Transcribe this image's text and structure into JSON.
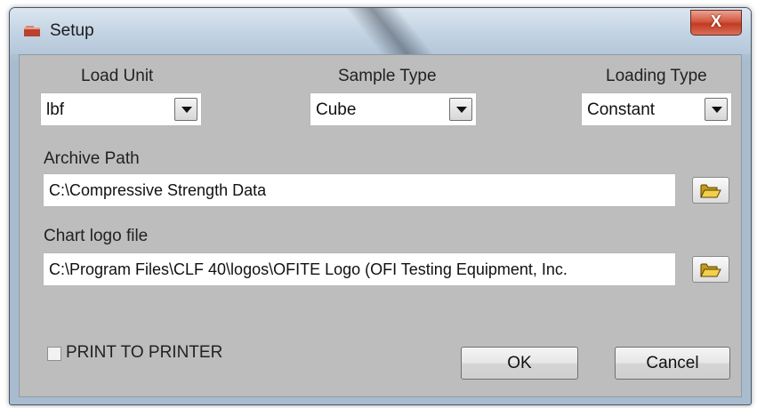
{
  "window": {
    "title": "Setup",
    "close_label": "X"
  },
  "load_unit": {
    "label": "Load Unit",
    "value": "lbf"
  },
  "sample_type": {
    "label": "Sample Type",
    "value": "Cube"
  },
  "loading_type": {
    "label": "Loading Type",
    "value": "Constant"
  },
  "archive_path": {
    "label": "Archive Path",
    "value": "C:\\Compressive Strength Data"
  },
  "chart_logo": {
    "label": "Chart logo file",
    "value": "C:\\Program Files\\CLF 40\\logos\\OFITE Logo (OFI Testing Equipment, Inc."
  },
  "print_to_printer": {
    "label": "PRINT TO PRINTER",
    "checked": false
  },
  "buttons": {
    "ok": "OK",
    "cancel": "Cancel"
  },
  "icons": {
    "window": "setup-app-icon",
    "browse": "folder-open-icon",
    "dropdown": "chevron-down-icon"
  }
}
